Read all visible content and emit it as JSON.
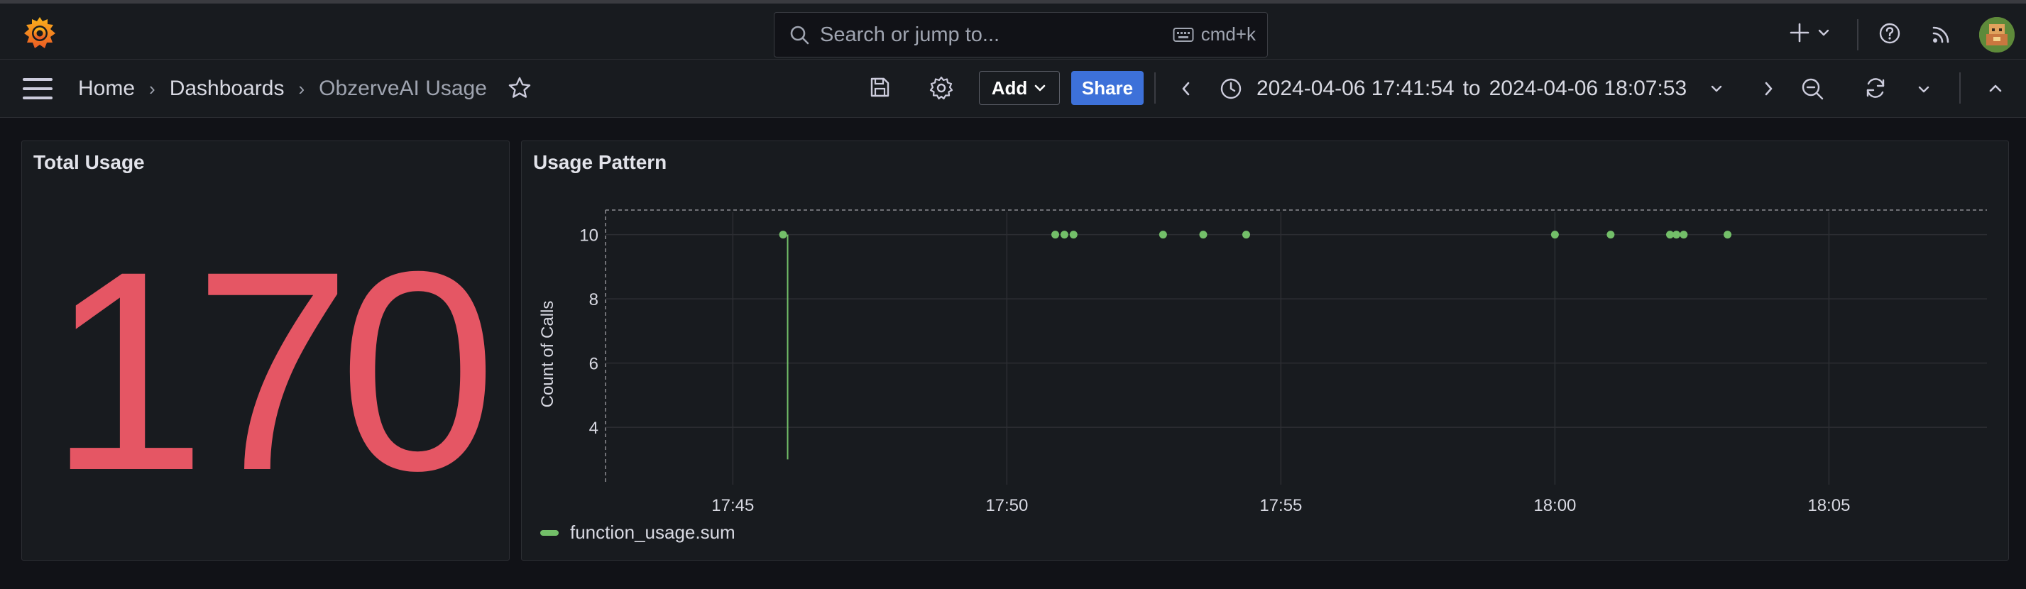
{
  "topbar": {
    "search_placeholder": "Search or jump to...",
    "shortcut": "cmd+k"
  },
  "navbar": {
    "breadcrumbs": [
      "Home",
      "Dashboards",
      "ObzerveAI Usage"
    ],
    "add_label": "Add",
    "share_label": "Share",
    "time_from": "2024-04-06 17:41:54",
    "time_to_word": "to",
    "time_to": "2024-04-06 18:07:53"
  },
  "colors": {
    "stat": "#e55664",
    "series": "#73bf69",
    "accent": "#3d71d9"
  },
  "icons": [
    "grafana-logo-icon",
    "search-icon",
    "keyboard-icon",
    "plus-icon",
    "chevron-down-icon",
    "help-icon",
    "rss-icon",
    "avatar",
    "menu-icon",
    "star-icon",
    "save-icon",
    "gear-icon",
    "chevron-left-icon",
    "clock-icon",
    "chevron-right-icon",
    "zoom-out-icon",
    "refresh-icon",
    "chevron-up-icon"
  ],
  "panels": {
    "stat": {
      "title": "Total Usage",
      "value": "170"
    },
    "timeseries": {
      "title": "Usage Pattern"
    }
  },
  "chart_data": {
    "type": "scatter",
    "title": "Usage Pattern",
    "xlabel": "",
    "ylabel": "Count of Calls",
    "x_ticks": [
      "17:45",
      "17:50",
      "17:55",
      "18:00",
      "18:05"
    ],
    "y_ticks": [
      4,
      6,
      8,
      10
    ],
    "ylim": [
      2.3,
      10.7
    ],
    "grid": true,
    "legend_position": "bottom-left",
    "series": [
      {
        "name": "function_usage.sum",
        "color": "#73bf69",
        "points": [
          {
            "x": "17:45:55",
            "y": 10
          },
          {
            "x": "17:50:53",
            "y": 10
          },
          {
            "x": "17:51:03",
            "y": 10
          },
          {
            "x": "17:51:13",
            "y": 10
          },
          {
            "x": "17:52:51",
            "y": 10
          },
          {
            "x": "17:53:35",
            "y": 10
          },
          {
            "x": "17:54:22",
            "y": 10
          },
          {
            "x": "18:00:00",
            "y": 10
          },
          {
            "x": "18:01:01",
            "y": 10
          },
          {
            "x": "18:02:06",
            "y": 10
          },
          {
            "x": "18:02:13",
            "y": 10
          },
          {
            "x": "18:02:21",
            "y": 10
          },
          {
            "x": "18:03:09",
            "y": 10
          }
        ],
        "spikes": [
          {
            "x": "17:46:00",
            "y_from": 3,
            "y_to": 10
          }
        ]
      }
    ]
  }
}
